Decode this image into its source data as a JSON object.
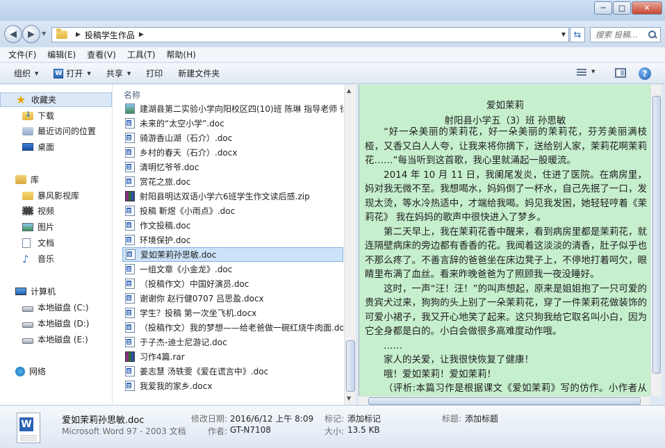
{
  "window": {
    "controls": {
      "minimize": "─",
      "maximize": "□",
      "close": "✕"
    }
  },
  "address": {
    "breadcrumb": "投稿学生作品",
    "search_placeholder": "搜索 投稿..."
  },
  "menu": [
    "文件(F)",
    "编辑(E)",
    "查看(V)",
    "工具(T)",
    "帮助(H)"
  ],
  "commands": {
    "organize": "组织",
    "open": "打开",
    "share": "共享",
    "print": "打印",
    "new_folder": "新建文件夹"
  },
  "nav": {
    "favorites": "收藏夹",
    "downloads": "下载",
    "recent": "最近访问的位置",
    "desktop": "桌面",
    "libraries": "库",
    "storm": "暴风影视库",
    "video": "视频",
    "pictures": "图片",
    "documents": "文档",
    "music": "音乐",
    "computer": "计算机",
    "disk_c": "本地磁盘 (C:)",
    "disk_d": "本地磁盘 (D:)",
    "disk_e": "本地磁盘 (E:)",
    "network": "网络"
  },
  "list": {
    "column_name": "名称",
    "files": [
      {
        "name": "建湖县第二实验小学向阳校区四(10)班 陈琳  指导老师 徐",
        "icon": "image"
      },
      {
        "name": "未来的“太空小学”.doc",
        "icon": "word"
      },
      {
        "name": "骑游香山湖（石介）.doc",
        "icon": "word"
      },
      {
        "name": "乡村的春天（石介）.docx",
        "icon": "word"
      },
      {
        "name": "清明忆爷爷.doc",
        "icon": "word"
      },
      {
        "name": "赏花之旅.doc",
        "icon": "word"
      },
      {
        "name": "射阳县明达双语小学六6班学生作文读后感.zip",
        "icon": "rar"
      },
      {
        "name": "投稿  靳煜《小雨点》.doc",
        "icon": "word"
      },
      {
        "name": "作文投稿.doc",
        "icon": "word"
      },
      {
        "name": "环境保护.doc",
        "icon": "word"
      },
      {
        "name": "爱如茉莉孙思敏.doc",
        "icon": "word",
        "selected": true
      },
      {
        "name": "一组文章《小金龙》.doc",
        "icon": "word"
      },
      {
        "name": "（投稿作文）中国好演员.doc",
        "icon": "word"
      },
      {
        "name": "谢谢你  赵行健0707 吕思盈.docx",
        "icon": "word"
      },
      {
        "name": "学生？投稿  第一次坐飞机.docx",
        "icon": "word"
      },
      {
        "name": "（投稿作文）我的梦想——给老爸做一碗红烧牛肉面.doc",
        "icon": "word"
      },
      {
        "name": "于子杰-迪士尼游记.doc",
        "icon": "word"
      },
      {
        "name": "习作4篇.rar",
        "icon": "rar"
      },
      {
        "name": "姜志慧 汤轶雯《爱在谎言中》.doc",
        "icon": "word"
      },
      {
        "name": "我爱我的家乡.docx",
        "icon": "word"
      }
    ]
  },
  "preview": {
    "title": "爱如茉莉",
    "byline": "射阳县小学五（3）班   孙思敏",
    "paragraphs": [
      "“好一朵美丽的茉莉花，好一朵美丽的茉莉花，芬芳美丽满枝桠，又香又白人人夸，让我来将你摘下，送给别人家，茉莉花啊茉莉花……”每当听到这首歌，我心里就涌起一股暖流。",
      "2014 年 10 月 11 日，我阑尾发炎，住进了医院。在病房里，妈对我无微不至。我想喝水，妈妈倒了一杯水，自己先抿了一口，发现太烫，等水冷热适中，才端给我喝。妈见我发困，她轻轻哼着《茉莉花》 我在妈妈的歌声中很快进入了梦乡。",
      "第二天早上，我在茉莉花香中醒来，看到病房里都是茉莉花，就连隔壁病床的旁边都有香香的花。我闻着这淡淡的清香，肚子似乎也不那么疼了。不善言辞的爸爸坐在床边凳子上，不停地打着呵欠，眼睛里布满了血丝。看来昨晚爸爸为了照顾我一夜没睡好。",
      "这时，一声“汪！汪！”的叫声想起，原来是姐姐抱了一只可爱的贵宾犬过来，狗狗的头上别了一朵茉莉花，穿了一件茉莉花做装饰的可爱小裙子，我又开心地笑了起来。这只狗我给它取名叫小白，因为它全身都是白的。小白会做很多高难度动作哦。",
      "……",
      "家人的关爱，让我很快恢复了健康！",
      "哦！爱如茉莉！爱如茉莉！",
      "（评析:本篇习作是根据课文《爱如茉莉》写的仿作。小作者从妈、爸、姐的关爱中明白爱就体现在平凡的小事中，关键我们要"
    ]
  },
  "details": {
    "name": "爱如茉莉孙思敏.doc",
    "type": "Microsoft Word 97 - 2003 文档",
    "modified_label": "修改日期:",
    "modified_value": "2016/6/12 上午 8:09",
    "author_label": "作者:",
    "author_value": "GT-N7108",
    "tags_label": "标记:",
    "tags_value": "添加标记",
    "size_label": "大小:",
    "size_value": "13.5 KB",
    "title_label": "标题:",
    "title_value": "添加标题"
  }
}
